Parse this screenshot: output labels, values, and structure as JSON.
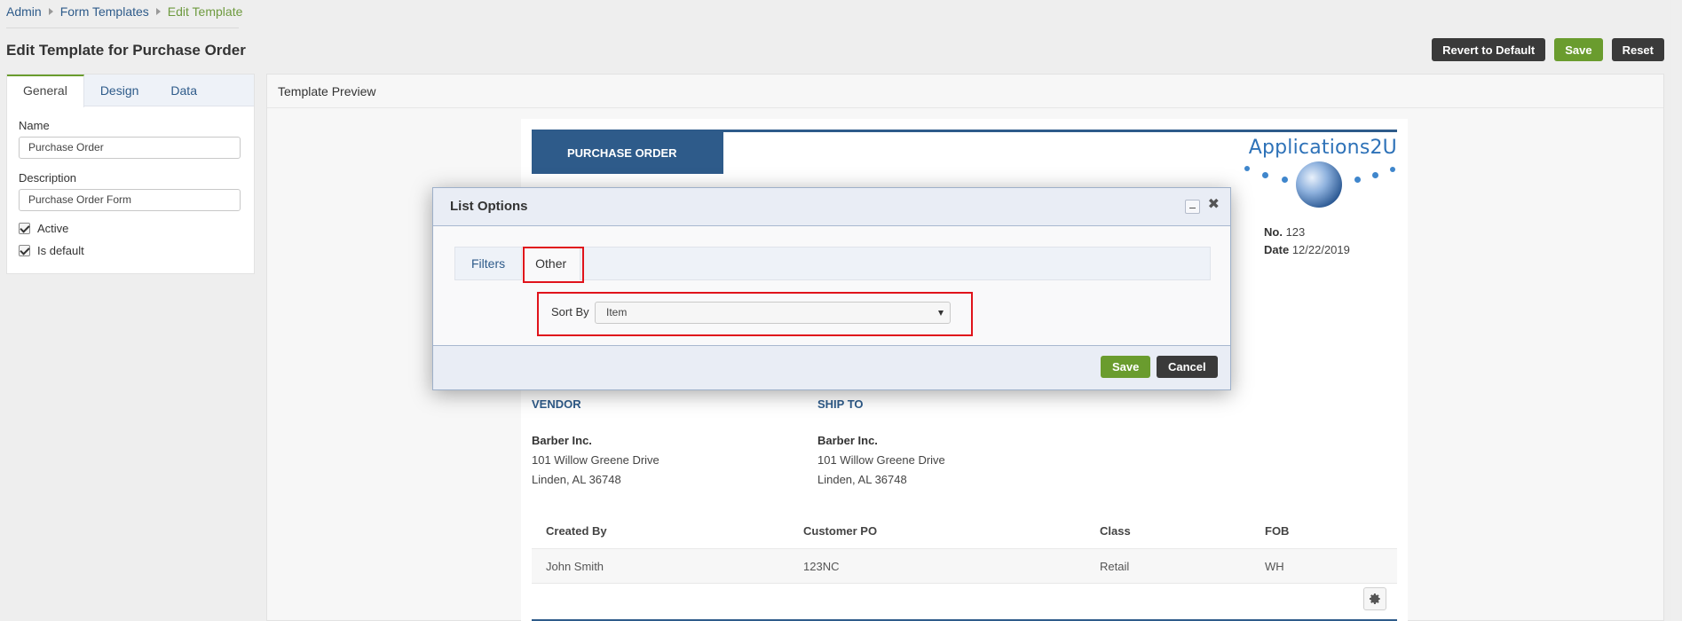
{
  "breadcrumb": {
    "items": [
      "Admin",
      "Form Templates"
    ],
    "current": "Edit Template"
  },
  "page": {
    "title": "Edit Template for Purchase Order"
  },
  "actions": {
    "revert": "Revert to Default",
    "save": "Save",
    "reset": "Reset"
  },
  "left_panel": {
    "tabs": [
      "General",
      "Design",
      "Data"
    ],
    "name_label": "Name",
    "name_value": "Purchase Order",
    "description_label": "Description",
    "description_value": "Purchase Order Form",
    "active_label": "Active",
    "is_default_label": "Is default"
  },
  "preview": {
    "title": "Template Preview",
    "banner": "PURCHASE ORDER",
    "logo_text": "Applications2U",
    "no_label": "No.",
    "no_value": "123",
    "date_label": "Date",
    "date_value": "12/22/2019",
    "vendor_heading": "VENDOR",
    "ship_to_heading": "SHIP TO",
    "vendor": {
      "name": "Barber Inc.",
      "street": "101 Willow Greene Drive",
      "city": "Linden, AL 36748"
    },
    "ship_to": {
      "name": "Barber Inc.",
      "street": "101 Willow Greene Drive",
      "city": "Linden, AL 36748"
    },
    "table": {
      "headers": [
        "Created By",
        "Customer PO",
        "Class",
        "FOB"
      ],
      "row": [
        "John Smith",
        "123NC",
        "Retail",
        "WH"
      ]
    }
  },
  "modal": {
    "title": "List Options",
    "tabs": [
      "Filters",
      "Other"
    ],
    "sort_by_label": "Sort By",
    "sort_by_value": "Item",
    "save": "Save",
    "cancel": "Cancel"
  },
  "colors": {
    "accent": "#2e5b8a",
    "save_green": "#6a9c2e",
    "highlight": "#e0131b"
  }
}
